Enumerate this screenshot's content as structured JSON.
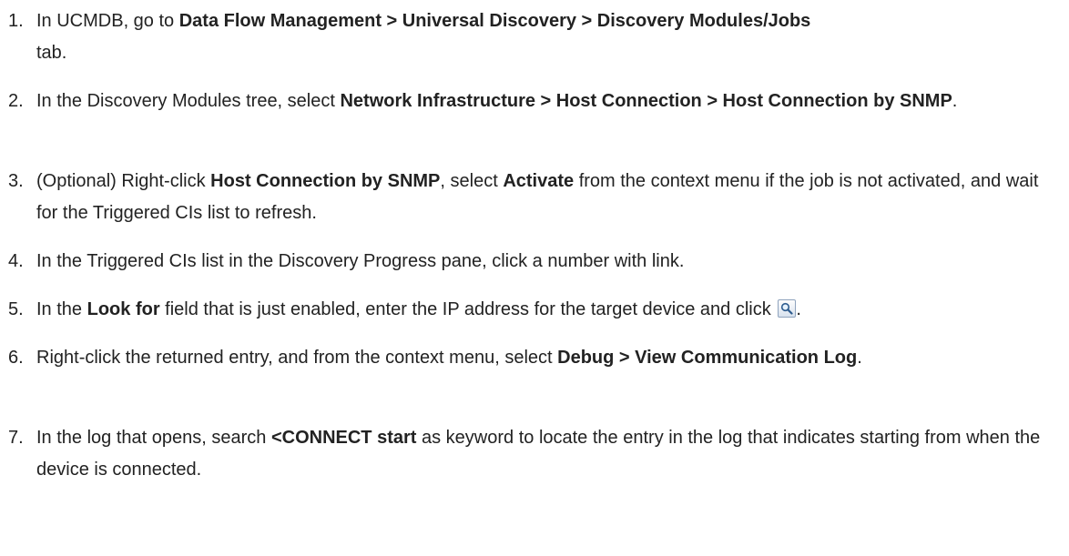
{
  "steps": [
    {
      "number": "1.",
      "parts": [
        {
          "t": "In UCMDB, go to "
        },
        {
          "b": "Data Flow Management > Universal Discovery > Discovery Modules/Jobs"
        },
        {
          "t": " tab."
        }
      ]
    },
    {
      "number": "2.",
      "parts": [
        {
          "t": "In the Discovery Modules tree, select "
        },
        {
          "b": "Network Infrastructure > Host Connection > Host Connection by SNMP"
        },
        {
          "t": "."
        }
      ]
    },
    {
      "number": "3.",
      "parts": [
        {
          "t": "(Optional) Right-click "
        },
        {
          "b": "Host Connection by SNMP"
        },
        {
          "t": ", select "
        },
        {
          "b": "Activate"
        },
        {
          "t": " from the context menu if the job is not activated, and wait for the Triggered CIs list to refresh."
        }
      ]
    },
    {
      "number": "4.",
      "parts": [
        {
          "t": "In the Triggered CIs list in the Discovery Progress pane, click a number with link."
        }
      ]
    },
    {
      "number": "5.",
      "parts": [
        {
          "t": "In the "
        },
        {
          "b": "Look for"
        },
        {
          "t": " field that is just enabled, enter the IP address for the target device and click "
        },
        {
          "icon": "search-icon"
        },
        {
          "t": "."
        }
      ]
    },
    {
      "number": "6.",
      "parts": [
        {
          "t": "Right-click the returned entry, and from the context menu, select "
        },
        {
          "b": "Debug > View Communication Log"
        },
        {
          "t": "."
        }
      ]
    },
    {
      "number": "7.",
      "parts": [
        {
          "t": "In the log that opens, search "
        },
        {
          "b": "<CONNECT start"
        },
        {
          "t": " as keyword to locate the entry in the log that indicates starting from when the device is connected."
        }
      ]
    }
  ]
}
